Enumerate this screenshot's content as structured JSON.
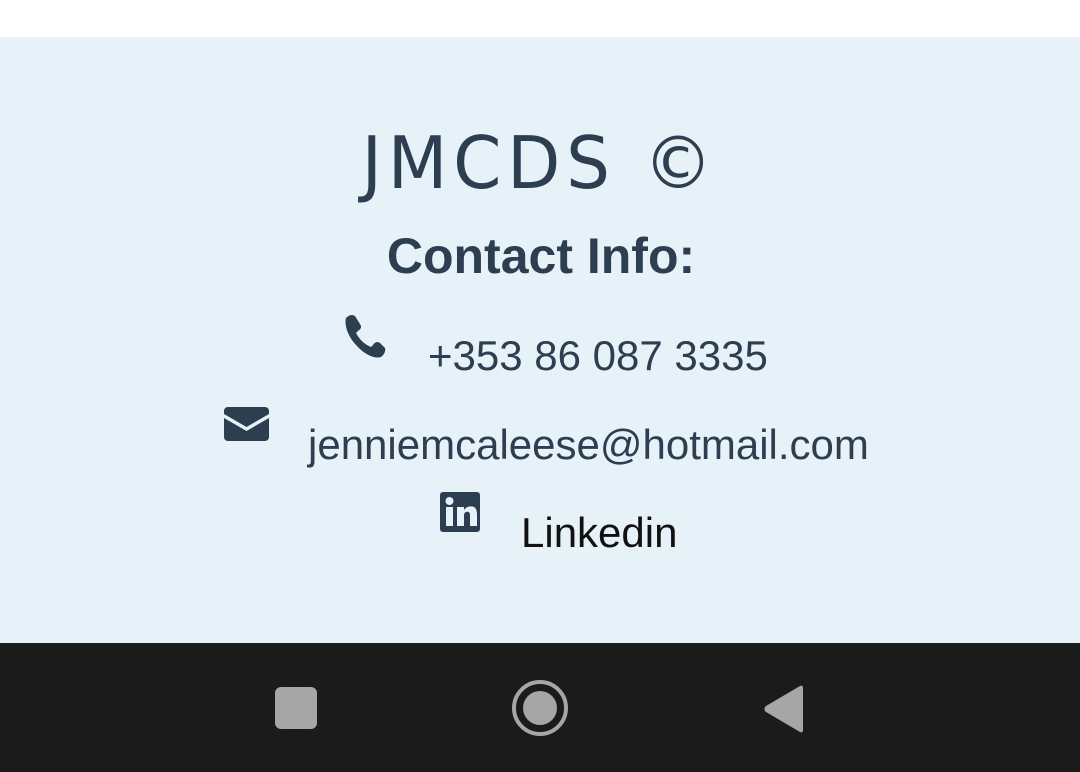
{
  "footer": {
    "brand": "JMCDS ©",
    "heading": "Contact Info:",
    "phone": {
      "icon": "phone-icon",
      "text": "+353 86 087 3335"
    },
    "email": {
      "icon": "envelope-icon",
      "text": "jenniemcaleese@hotmail.com"
    },
    "linkedin": {
      "icon": "linkedin-icon",
      "text": "Linkedin"
    }
  },
  "navigation_bar": {
    "buttons": [
      {
        "icon": "recent-apps-square-icon"
      },
      {
        "icon": "home-circle-icon"
      },
      {
        "icon": "back-triangle-icon"
      }
    ]
  },
  "colors": {
    "text": "#2c3e50",
    "footer_background": "#e7f1f8",
    "navbar_background": "#1b1b1b",
    "navbar_icons": "#a6a6a6"
  }
}
